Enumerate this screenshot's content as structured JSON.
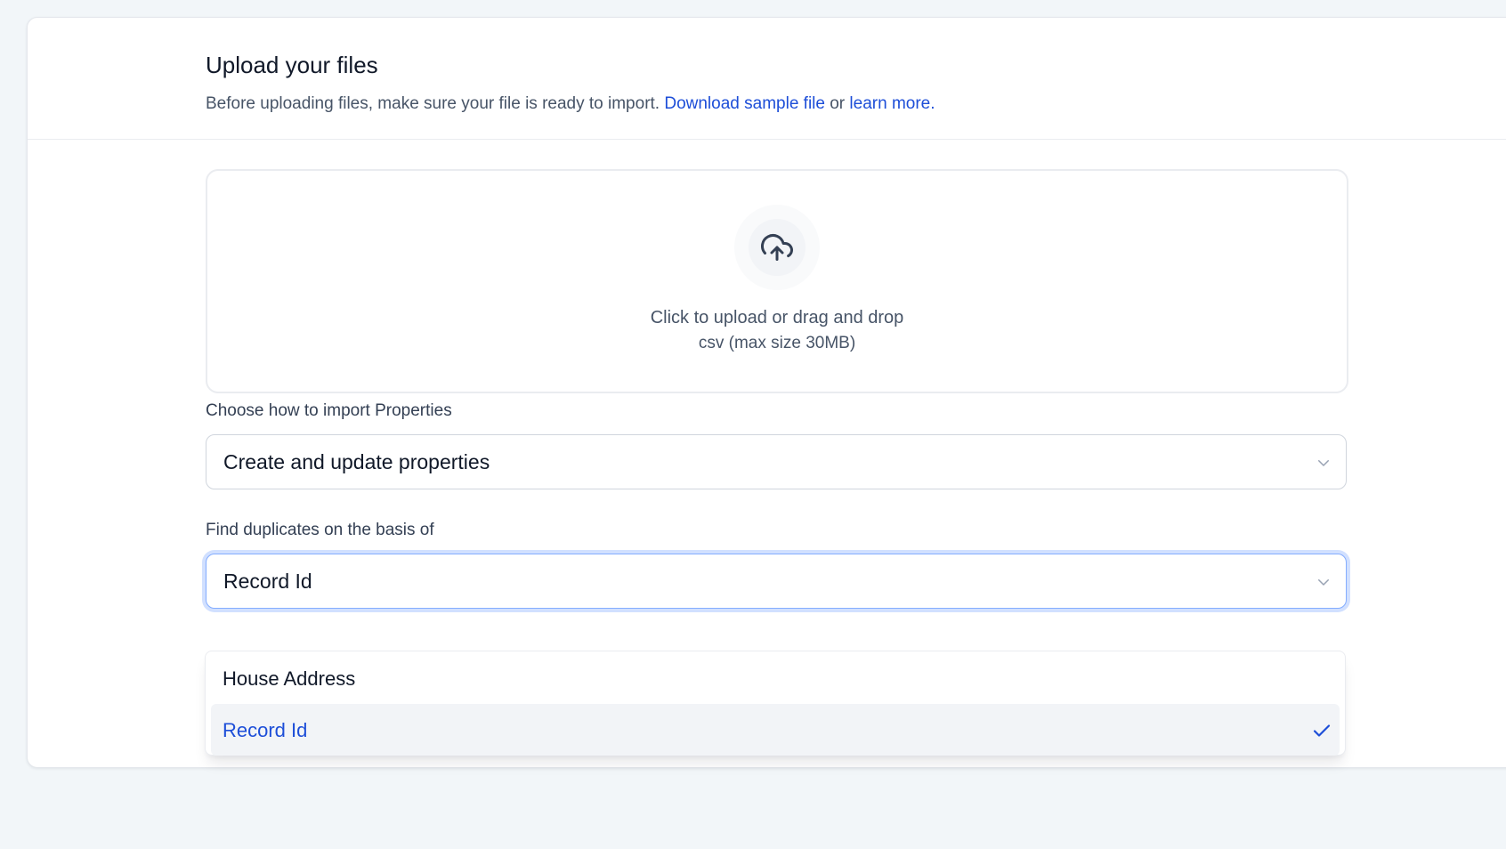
{
  "header": {
    "title": "Upload your files",
    "subtitle_prefix": "Before uploading files, make sure your file is ready to import.",
    "download_link": "Download sample file",
    "connector": "or",
    "learn_more_link": "learn more."
  },
  "dropzone": {
    "icon": "upload-cloud-icon",
    "primary_text": "Click to upload or drag and drop",
    "secondary_text": "csv (max size 30MB)"
  },
  "import_mode": {
    "label": "Choose how to import Properties",
    "selected_value": "Create and update properties"
  },
  "duplicates": {
    "label": "Find duplicates on the basis of",
    "selected_value": "Record Id",
    "options": [
      {
        "label": "House Address",
        "selected": false
      },
      {
        "label": "Record Id",
        "selected": true
      }
    ]
  },
  "colors": {
    "accent": "#1d4ed8",
    "focus_ring": "#d1e0ff",
    "background": "#f2f6f9"
  }
}
